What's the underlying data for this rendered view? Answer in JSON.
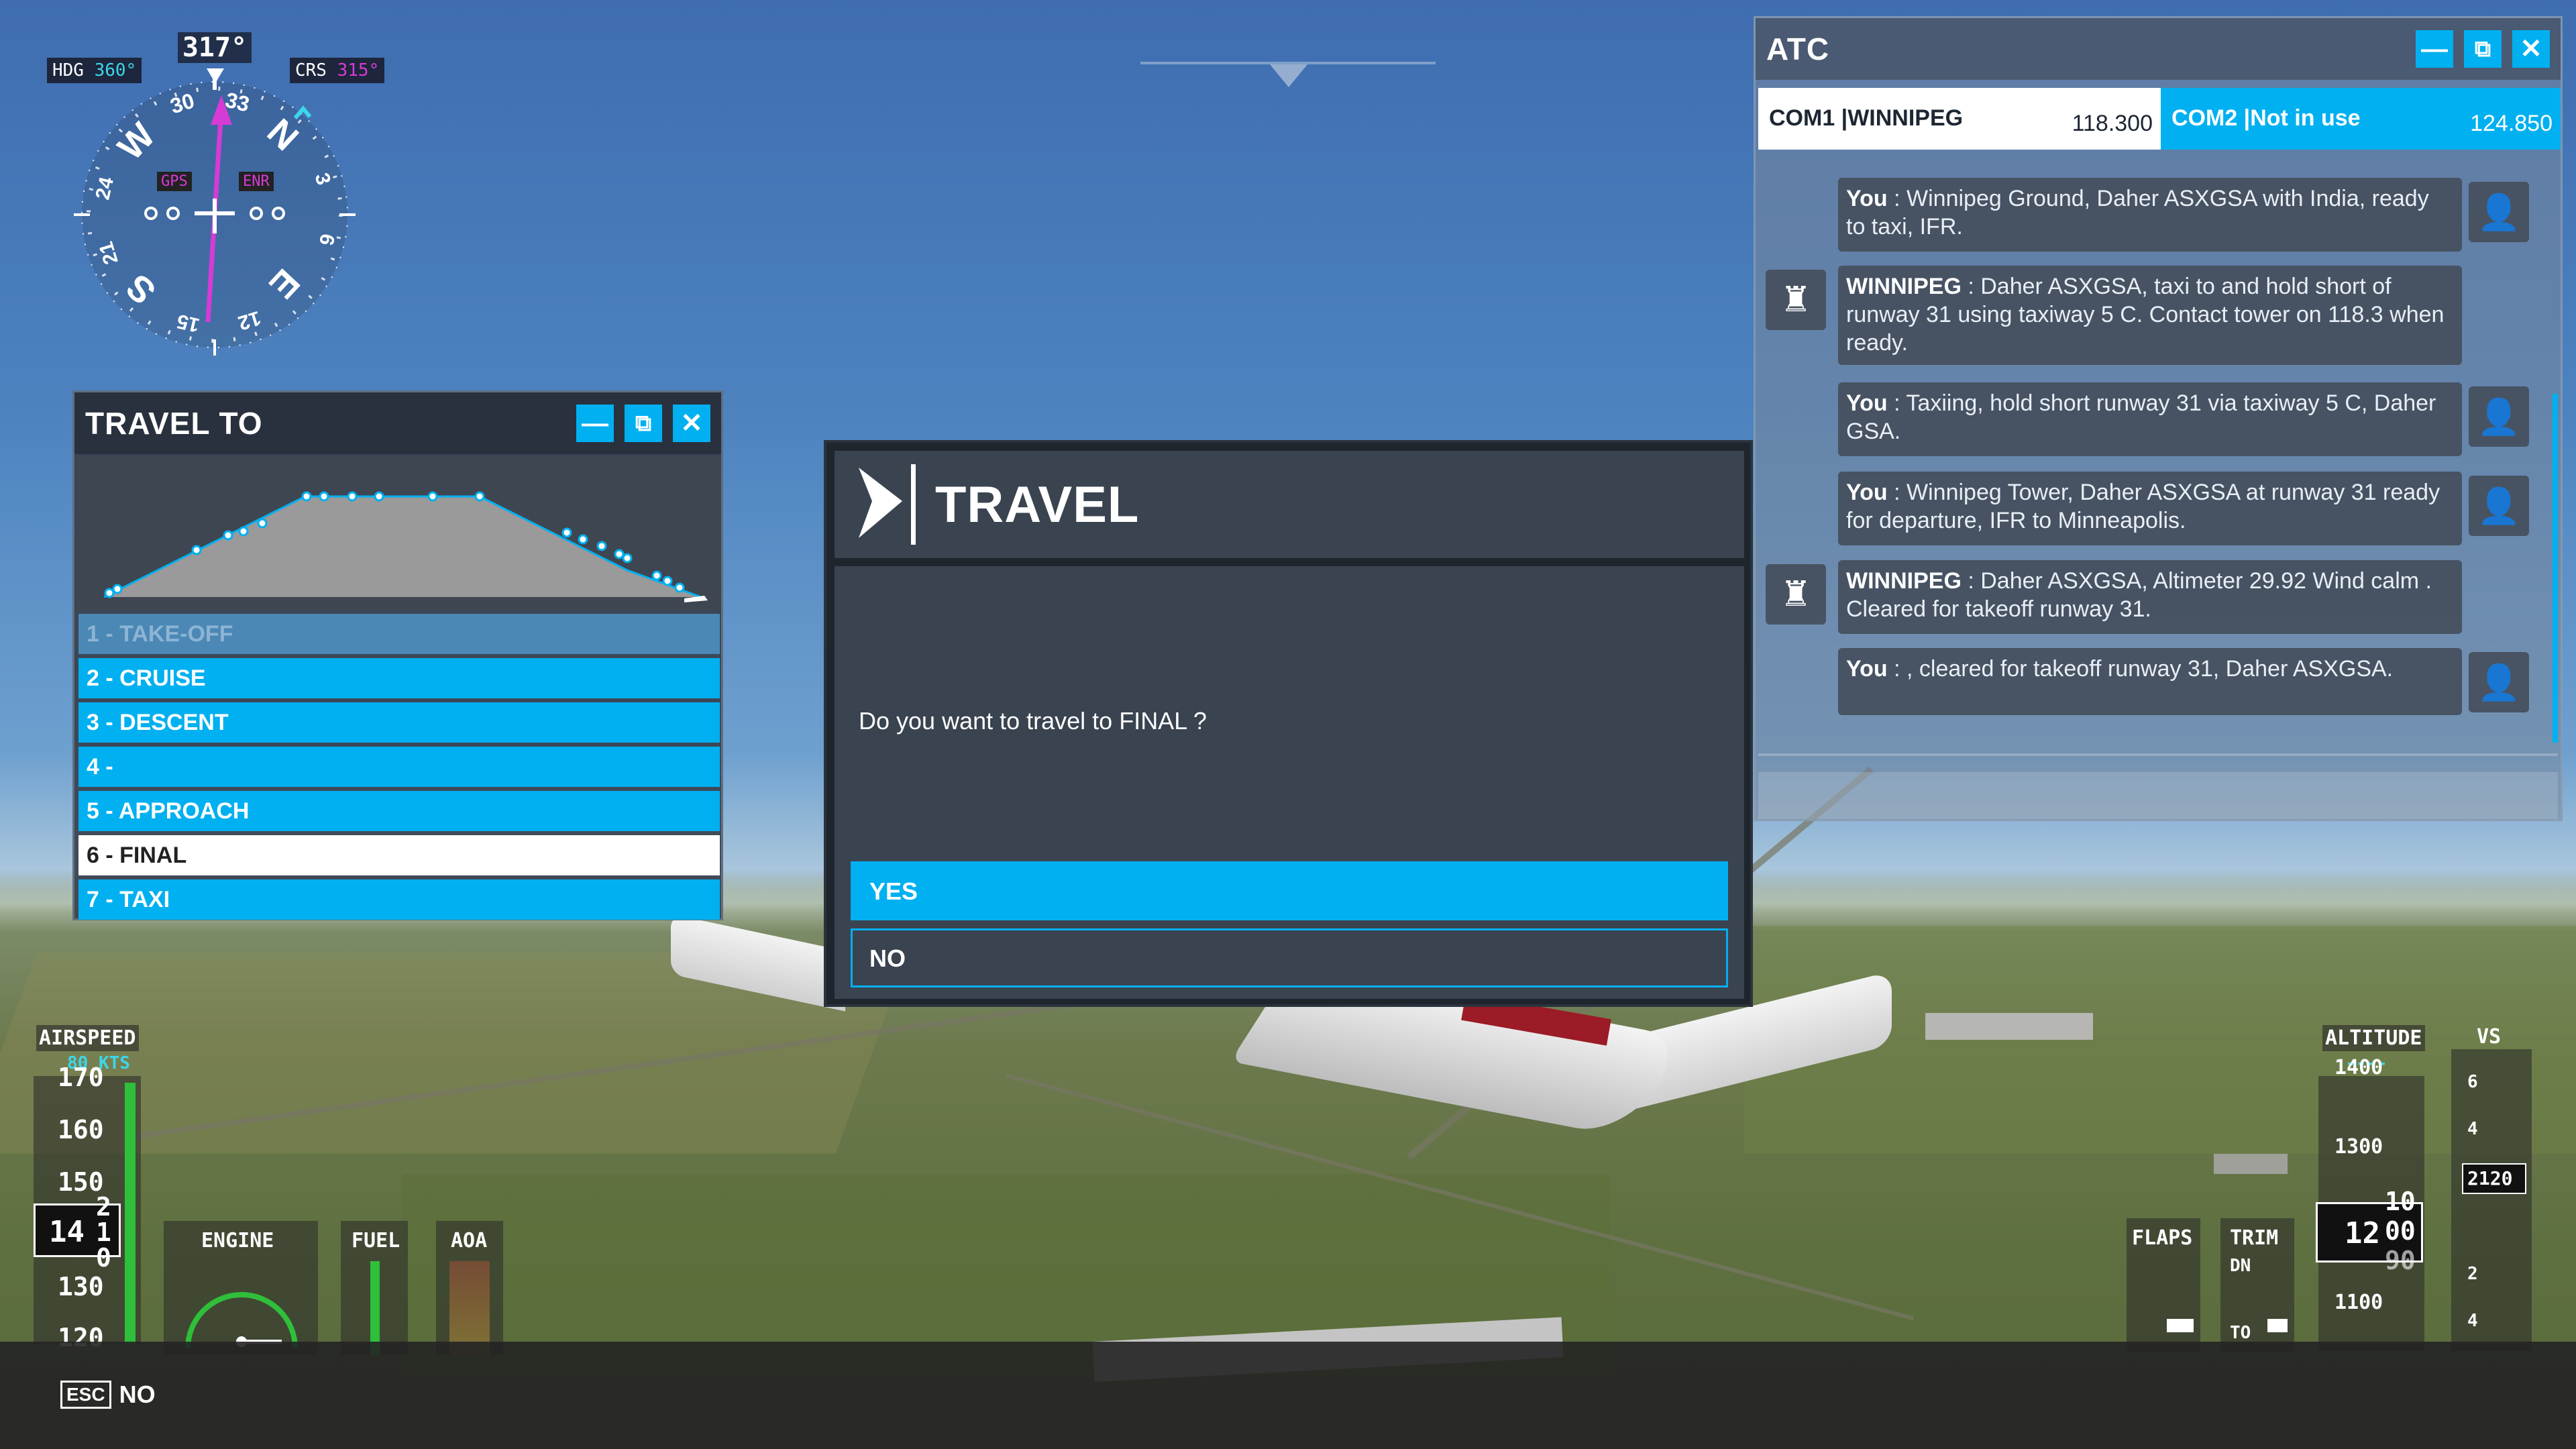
{
  "compass": {
    "hdg_label": "HDG",
    "hdg_value": "360°",
    "heading": "317°",
    "crs_label": "CRS",
    "crs_value": "315°",
    "gps_badge": "GPS",
    "enr_badge": "ENR",
    "cardinal_n": "N",
    "cardinal_e": "E",
    "cardinal_s": "S",
    "cardinal_w": "W",
    "tick_33": "33",
    "tick_30": "30",
    "tick_3": "3",
    "tick_6": "6",
    "tick_12": "12",
    "tick_15": "15",
    "tick_21": "21",
    "tick_24": "24"
  },
  "travel_to": {
    "title": "TRAVEL TO",
    "stages": [
      {
        "label": "1 - TAKE-OFF",
        "state": "done"
      },
      {
        "label": "2 - CRUISE",
        "state": "available"
      },
      {
        "label": "3 - DESCENT",
        "state": "available"
      },
      {
        "label": "4 -",
        "state": "available"
      },
      {
        "label": "5 - APPROACH",
        "state": "available"
      },
      {
        "label": "6 - FINAL",
        "state": "selected"
      },
      {
        "label": "7 - TAXI",
        "state": "available"
      }
    ]
  },
  "travel_dialog": {
    "title": "TRAVEL",
    "question": "Do you want to travel to FINAL ?",
    "yes_label": "YES",
    "no_label": "NO"
  },
  "atc": {
    "title": "ATC",
    "com1_name": "COM1 |WINNIPEG",
    "com1_freq": "118.300",
    "com2_name": "COM2 |Not in use",
    "com2_freq": "124.850",
    "messages": [
      {
        "speaker": "You",
        "text": " : Winnipeg Ground, Daher ASXGSA with India, ready to taxi, IFR."
      },
      {
        "speaker": "WINNIPEG",
        "text": " : Daher ASXGSA, taxi to and hold short of runway 31 using taxiway 5 C. Contact tower on 118.3 when ready."
      },
      {
        "speaker": "You",
        "text": " : Taxiing, hold short runway 31 via taxiway 5 C, Daher GSA."
      },
      {
        "speaker": "You",
        "text": " : Winnipeg Tower, Daher ASXGSA at runway 31 ready for departure, IFR to Minneapolis."
      },
      {
        "speaker": "WINNIPEG",
        "text": " : Daher ASXGSA, Altimeter 29.92 Wind calm . Cleared for takeoff runway 31."
      },
      {
        "speaker": "You",
        "text": " : , cleared for takeoff runway 31, Daher ASXGSA."
      }
    ]
  },
  "airspeed": {
    "label": "AIRSPEED",
    "selected": "80 KTS",
    "ticks": [
      "170",
      "160",
      "150",
      "130",
      "120"
    ],
    "current_main": "14",
    "current_digit_top": "2",
    "current_digit_mid": "1",
    "current_digit_bot": "0"
  },
  "engine": {
    "label": "ENGINE"
  },
  "fuel": {
    "label": "FUEL"
  },
  "aoa": {
    "label": "AOA"
  },
  "altitude": {
    "label": "ALTITUDE",
    "selected": "----",
    "ticks": [
      "1400",
      "1300",
      "1100"
    ],
    "current_main": "12",
    "current_top": "10",
    "current_mid": "00",
    "current_bot": "90"
  },
  "vs": {
    "label": "VS",
    "ticks": [
      "6",
      "4",
      "2",
      "4"
    ],
    "current": "2120"
  },
  "flaps": {
    "label": "FLAPS"
  },
  "trim": {
    "label": "TRIM",
    "dn": "DN",
    "to": "TO"
  },
  "footer": {
    "key": "ESC",
    "action": "NO"
  },
  "colors": {
    "accent": "#00b0f0",
    "magenta": "#d63bd6",
    "panel": "#363e4a"
  }
}
